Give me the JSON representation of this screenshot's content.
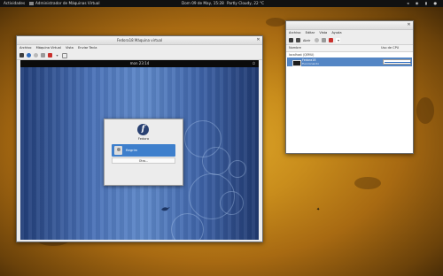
{
  "top_panel": {
    "activities": "Actividades",
    "app_name": "Administrador de Máquinas Virtual",
    "clock": "Dom 09 de May, 15:28",
    "weather": "Partly Cloudy, 22 °C",
    "tray_icons": [
      "sound-icon",
      "network-icon",
      "battery-icon",
      "user-icon"
    ],
    "tray_text": "◂ ◉ ▮ ●"
  },
  "vm_window": {
    "title": "Fedora18 Máquina virtual",
    "menu": [
      "Archivo",
      "Máquina Virtual",
      "Vista",
      "Enviar Tecla"
    ],
    "close": "✕",
    "guest": {
      "clock": "mon 23:14",
      "power_icon": "⏻",
      "logo_letter": "f",
      "distro_label": "Fedora",
      "user_name": "ftegrim",
      "other_label": "Otro..."
    }
  },
  "vmm_window": {
    "menu": [
      "Archivo",
      "Editar",
      "Vista",
      "Ayuda"
    ],
    "close": "✕",
    "toolbar_open_label": "Abrir",
    "columns": {
      "name": "Nombre",
      "cpu": "Uso de CPU"
    },
    "group": "localhost (QEMU)",
    "vm": {
      "name": "Fedora18",
      "state": "Funcionando"
    }
  },
  "colors": {
    "selection_blue": "#5486c5",
    "fedora_blue": "#294172",
    "desktop_gold": "#c98d1c"
  }
}
